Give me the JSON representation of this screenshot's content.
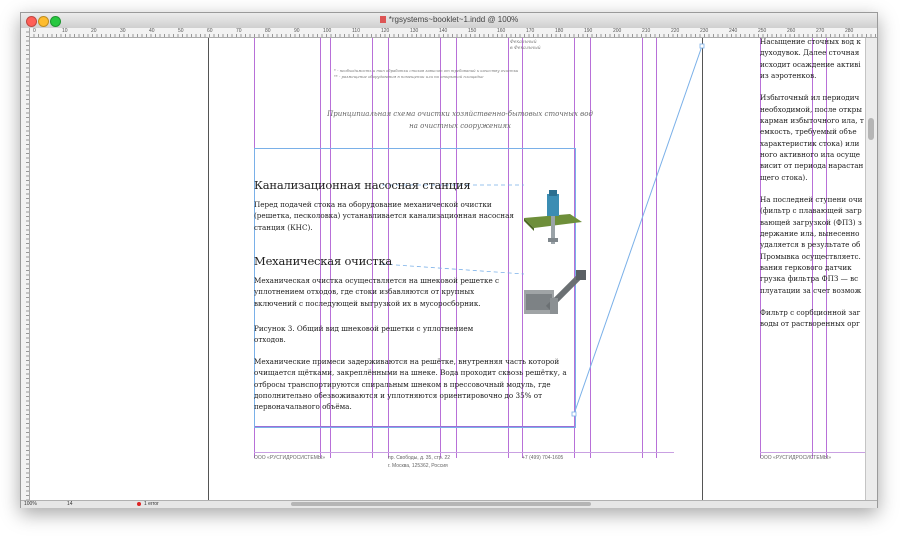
{
  "window": {
    "title": "*rgsystems~booklet~1.indd @ 100%"
  },
  "ruler": {
    "ticks": [
      "0",
      "10",
      "20",
      "30",
      "40",
      "50",
      "60",
      "70",
      "80",
      "90",
      "100",
      "110",
      "120",
      "130",
      "140",
      "150",
      "160",
      "170",
      "180",
      "190",
      "200",
      "210",
      "220",
      "230",
      "240",
      "250",
      "260",
      "270",
      "280"
    ]
  },
  "page": {
    "top_note_1": "Фекальный",
    "top_note_2": "в Фекальный",
    "small_note_1": "* - необходимость и тип обработки стоков зависит от требований к качеству очистки",
    "small_note_2": "** - размещение оборудования в помещении или на открытой площадке",
    "caption_line1": "Принципиальная схема очистки хозяйственно-бытовых сточных вод",
    "caption_line2": "на очистных сооружениях",
    "section1_heading": "Канализационная насосная станция",
    "section1_p1": "Перед подачей стока на оборудование механической очистки (решетка, песколовка) устанавливается канализационная насосная станция (КНС).",
    "section2_heading": "Механическая очистка",
    "section2_p1": "Механическая очистка осуществляется на шнековой решетке с уплотнением отходов, где стоки избавляются от крупных включений с последующей выгрузкой их в мусоросборник.",
    "section2_p2": "Рисунок 3. Общий вид шнековой решетки с уплотнением отходов.",
    "section2_p3": "Механические примеси задерживаются на решётке, внутренняя часть которой очищается щётками, закреплёнными на шнеке. Вода проходит сквозь решётку, а отбросы транспортируются спиральным шнеком в прессовочный модуль, где дополнительно обезвоживаются и уплотняются ориентировочно до 35% от первоначального объёма.",
    "footer_company": "ООО «РУСГИДРОСИСТЕМЫ»",
    "footer_address_1": "пр. Свободы, д. 35, стр. 22",
    "footer_address_2": "г. Москва, 125362, Россия",
    "footer_phone": "+7 (499) 704-1605",
    "right_footer_company": "ООО «РУСГИДРОСИСТЕМЫ»"
  },
  "right_page": {
    "lines": [
      "Насыщение сточных вод к",
      "духодувок. Далее сточная",
      "исходит осаждение активі",
      "из аэротенков.",
      "",
      "Избыточный ил периодич",
      "необходимой, после откры",
      "карман избыточного ила, т",
      "емкость, требуемый объе",
      "характеристик стока) или",
      "ного активного ила  осуще",
      "висит от периода нарастан",
      "щего стока).",
      "",
      "На последней ступени очи",
      "(фильтр с плавающей загр",
      "вающей загрузкой (ФПЗ) з",
      "держание ила, вынесенно",
      "удаляется в результате об",
      "Промывка осуществляетс.",
      "вания геркового датчик",
      "грузка фильтра ФПЗ — вс",
      "плуатации за счет возмож",
      "",
      "Фильтр с сорбционной заг",
      "воды от растворенных орг"
    ]
  },
  "statusbar": {
    "zoom": "100%",
    "page_number": "14",
    "preflight": "1 error"
  },
  "colors": {
    "guide": "#b870d8",
    "frame": "#7ab0e8"
  }
}
